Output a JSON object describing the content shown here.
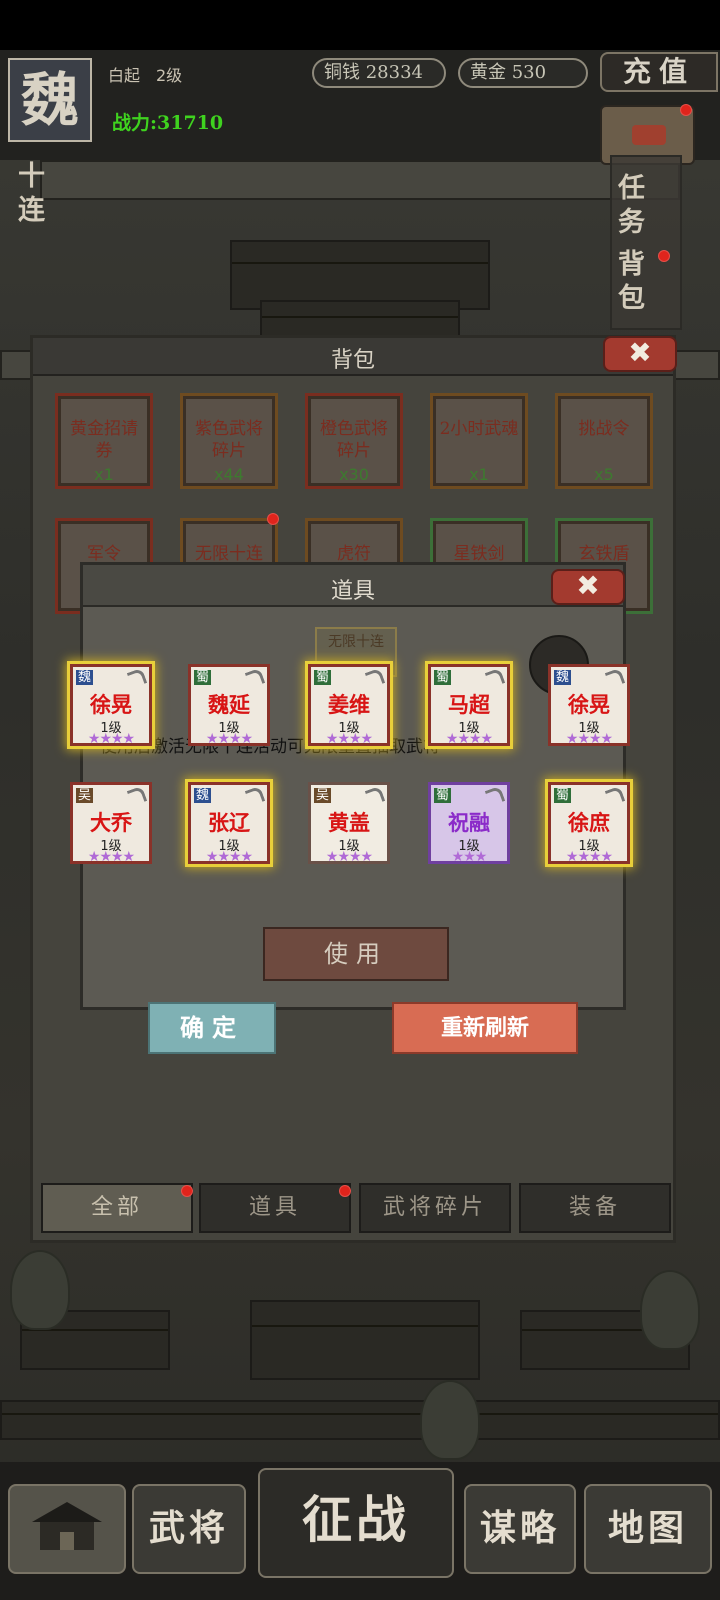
{
  "hud": {
    "kingdom": "魏",
    "player_name": "白起",
    "player_level": "2级",
    "power": "战力:31710",
    "copper": "铜钱 28334",
    "gold": "黄金 530",
    "recharge": "充值"
  },
  "side": {
    "ten_pull": "十连",
    "tasks": "任务",
    "backpack": "背包"
  },
  "backpack": {
    "title": "背包",
    "close": "✖",
    "items_row1": [
      {
        "name": "黄金招请券",
        "count": "x1"
      },
      {
        "name": "紫色武将碎片",
        "count": "x44"
      },
      {
        "name": "橙色武将碎片",
        "count": "x30"
      },
      {
        "name": "2小时武魂",
        "count": "x1"
      },
      {
        "name": "挑战令",
        "count": "x5"
      }
    ],
    "items_row2": [
      {
        "name": "军令"
      },
      {
        "name": "无限十连"
      },
      {
        "name": "虎符"
      },
      {
        "name": "星铁剑"
      },
      {
        "name": "玄铁盾"
      }
    ],
    "tabs": [
      "全部",
      "道具",
      "武将碎片",
      "装备"
    ]
  },
  "item_popup": {
    "title": "道具",
    "close": "✖",
    "preview_label": "无限十连",
    "description": "使用后激活无限十连活动可无限重置抽取武将",
    "use_button": "使用"
  },
  "draw_results": [
    {
      "kingdom": "魏",
      "name": "徐晃",
      "level": "1级",
      "stars": "★★★★"
    },
    {
      "kingdom": "蜀",
      "name": "魏延",
      "level": "1级",
      "stars": "★★★★"
    },
    {
      "kingdom": "蜀",
      "name": "姜维",
      "level": "1级",
      "stars": "★★★★"
    },
    {
      "kingdom": "蜀",
      "name": "马超",
      "level": "1级",
      "stars": "★★★★"
    },
    {
      "kingdom": "魏",
      "name": "徐晃",
      "level": "1级",
      "stars": "★★★★"
    },
    {
      "kingdom": "吴",
      "name": "大乔",
      "level": "1级",
      "stars": "★★★★"
    },
    {
      "kingdom": "魏",
      "name": "张辽",
      "level": "1级",
      "stars": "★★★★"
    },
    {
      "kingdom": "吴",
      "name": "黄盖",
      "level": "1级",
      "stars": "★★★★"
    },
    {
      "kingdom": "蜀",
      "name": "祝融",
      "level": "1级",
      "stars": "★★★"
    },
    {
      "kingdom": "蜀",
      "name": "徐庶",
      "level": "1级",
      "stars": "★★★★"
    }
  ],
  "buttons": {
    "confirm": "确定",
    "refresh": "重新刷新"
  },
  "nav": {
    "generals": "武将",
    "campaign": "征战",
    "strategy": "谋略",
    "map": "地图"
  },
  "colors": {
    "power_green": "#3fd21f",
    "confirm_teal": "#7fb1b4",
    "refresh_orange": "#d86c53",
    "legend_red": "#d81515",
    "epic_purple": "#8b2bc9"
  }
}
